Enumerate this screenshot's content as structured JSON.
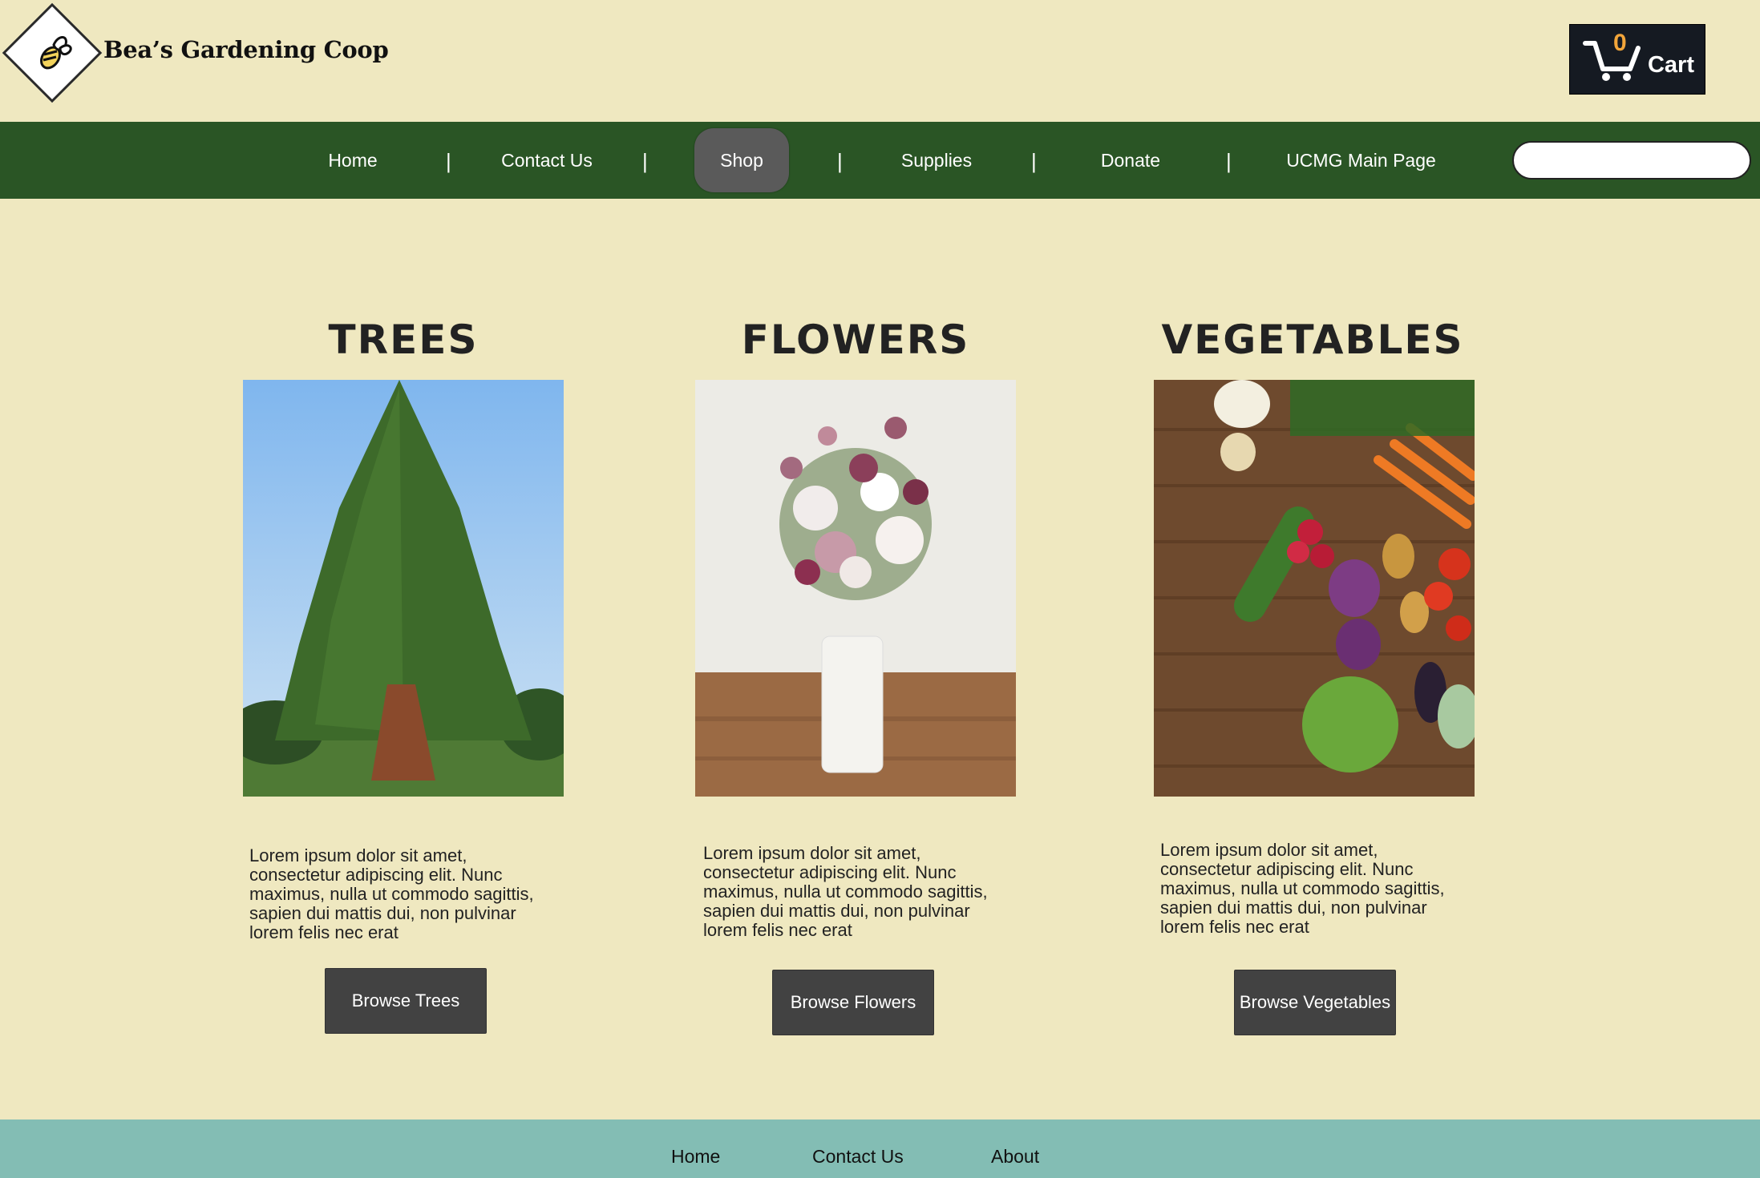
{
  "brand": {
    "name": "Bea’s Gardening Coop"
  },
  "cart": {
    "count": "0",
    "label": "Cart"
  },
  "nav": {
    "items": [
      "Home",
      "Contact Us",
      "Shop",
      "Supplies",
      "Donate",
      "UCMG Main Page"
    ],
    "active": "Shop",
    "separator": "|"
  },
  "search": {
    "placeholder": ""
  },
  "categories": [
    {
      "title": "TREES",
      "description": "Lorem ipsum dolor sit amet, consectetur adipiscing elit. Nunc maximus, nulla ut commodo sagittis, sapien dui mattis dui, non pulvinar lorem felis nec erat",
      "button": "Browse Trees"
    },
    {
      "title": "FLOWERS",
      "description": "Lorem ipsum dolor sit amet, consectetur adipiscing elit. Nunc maximus, nulla ut commodo sagittis, sapien dui mattis dui, non pulvinar lorem felis nec erat",
      "button": "Browse Flowers"
    },
    {
      "title": "VEGETABLES",
      "description": "Lorem ipsum dolor sit amet, consectetur adipiscing elit. Nunc maximus, nulla ut commodo sagittis, sapien dui mattis dui, non pulvinar lorem felis nec erat",
      "button": "Browse Vegetables"
    }
  ],
  "footer": {
    "links": [
      "Home",
      "Contact Us",
      "About"
    ]
  },
  "colors": {
    "background": "#efe8c0",
    "nav": "#2a5525",
    "active_pill": "#5a5a5a",
    "button": "#424242",
    "footer": "#83bdb4",
    "cart_bg": "#151a22",
    "cart_count": "#f2a53a"
  }
}
